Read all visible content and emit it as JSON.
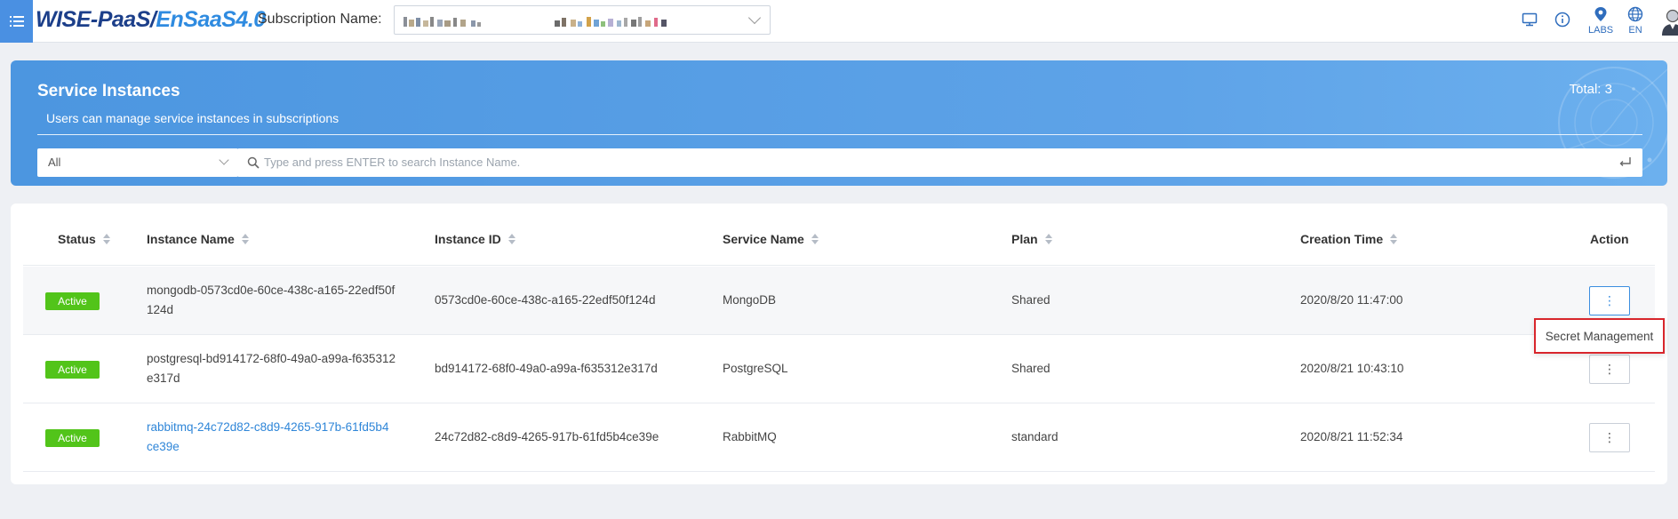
{
  "header": {
    "logo_part1": "WISE-PaaS/",
    "logo_part2": "EnSaaS4.0",
    "subscription_label": "Subscription Name:",
    "subscription_value": "",
    "icons": [
      "menu-icon",
      "monitor-icon",
      "info-icon",
      "location-pin-icon",
      "globe-icon",
      "user-avatar-icon"
    ],
    "labs_label": "LABS",
    "lang_label": "EN"
  },
  "banner": {
    "title": "Service Instances",
    "description": "Users can manage service instances in subscriptions",
    "total": "Total: 3",
    "filter_value": "All",
    "search_placeholder": "Type and press ENTER to search Instance Name."
  },
  "table": {
    "columns": [
      "Status",
      "Instance Name",
      "Instance ID",
      "Service Name",
      "Plan",
      "Creation Time",
      "Action"
    ],
    "rows": [
      {
        "status": "Active",
        "name_line1": "mongodb-0573cd0e-60ce-438c-a165-22edf50f",
        "name_line2": "124d",
        "id": "0573cd0e-60ce-438c-a165-22edf50f124d",
        "service": "MongoDB",
        "plan": "Shared",
        "created": "2020/8/20 11:47:00",
        "action": "⋮"
      },
      {
        "status": "Active",
        "name_line1": "postgresql-bd914172-68f0-49a0-a99a-f635312",
        "name_line2": "e317d",
        "id": "bd914172-68f0-49a0-a99a-f635312e317d",
        "service": "PostgreSQL",
        "plan": "Shared",
        "created": "2020/8/21 10:43:10",
        "action": "⋮"
      },
      {
        "status": "Active",
        "name_line1": "rabbitmq-24c72d82-c8d9-4265-917b-61fd5b4",
        "name_line2": "ce39e",
        "id": "24c72d82-c8d9-4265-917b-61fd5b4ce39e",
        "service": "RabbitMQ",
        "plan": "standard",
        "created": "2020/8/21 11:52:34",
        "action": "⋮"
      }
    ]
  },
  "popover": {
    "item": "Secret Management"
  },
  "colors": {
    "brand_dark": "#1c3f8a",
    "brand_light": "#2f8be0",
    "banner": "#4c96e0",
    "active_badge": "#52c41a",
    "highlight_border": "#d8262c",
    "link": "#2f86d8"
  }
}
